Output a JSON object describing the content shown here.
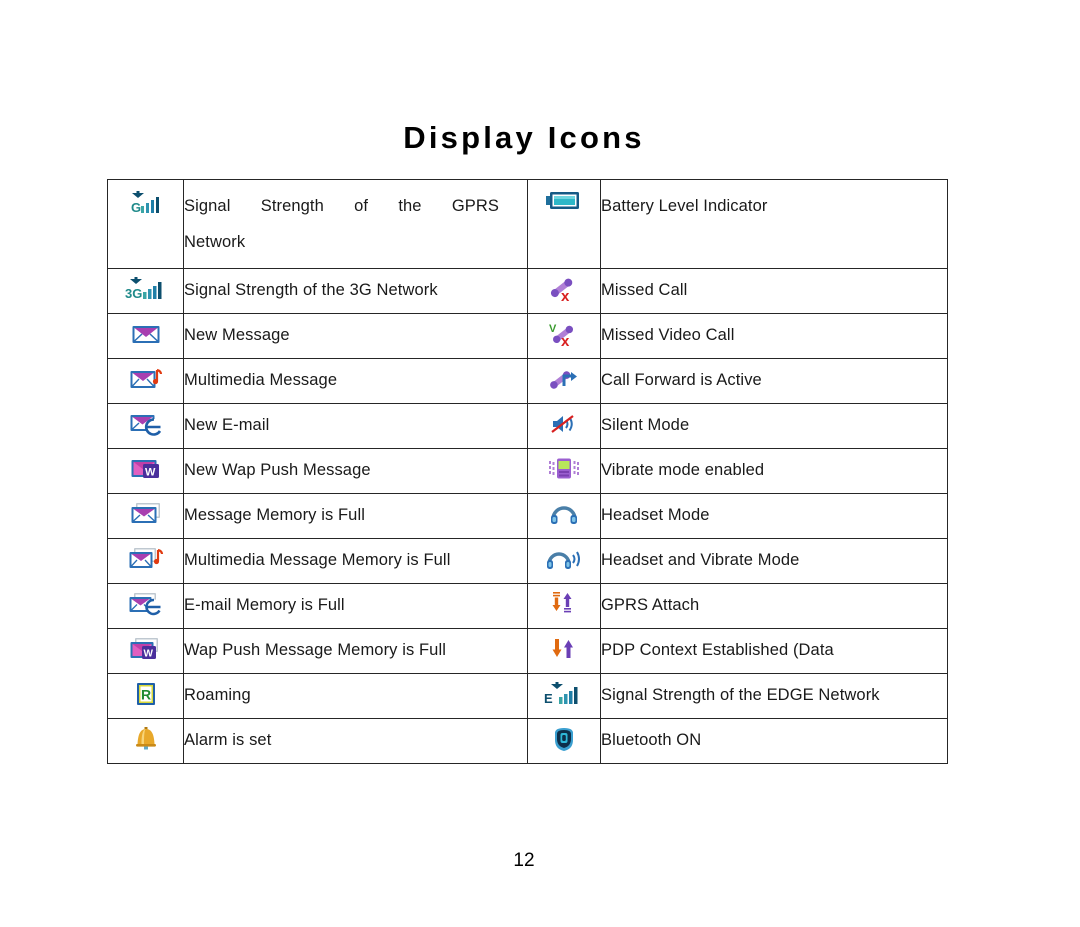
{
  "document": {
    "title": "Display Icons",
    "page_number": "12"
  },
  "table": {
    "left_column": [
      {
        "icon": "signal-strength-gprs-icon",
        "label_line1": "Signal Strength of the GPRS",
        "label_line2": "Network",
        "justified": true
      },
      {
        "icon": "signal-strength-3g-icon",
        "label_line1": "Signal Strength of the 3G Network",
        "label_line2": "",
        "justified": false
      },
      {
        "icon": "new-message-envelope-icon",
        "label_line1": "New Message",
        "label_line2": "",
        "justified": false
      },
      {
        "icon": "multimedia-message-icon",
        "label_line1": "Multimedia Message",
        "label_line2": "",
        "justified": false
      },
      {
        "icon": "new-email-icon",
        "label_line1": "New E-mail",
        "label_line2": "",
        "justified": false
      },
      {
        "icon": "new-wap-push-message-icon",
        "label_line1": "New Wap Push Message",
        "label_line2": "",
        "justified": false
      },
      {
        "icon": "message-memory-full-icon",
        "label_line1": "Message Memory is Full",
        "label_line2": "",
        "justified": false
      },
      {
        "icon": "multimedia-message-memory-full-icon",
        "label_line1": "Multimedia Message Memory is Full",
        "label_line2": "",
        "justified": false
      },
      {
        "icon": "email-memory-full-icon",
        "label_line1": "E-mail Memory is Full",
        "label_line2": "",
        "justified": false
      },
      {
        "icon": "wap-push-message-memory-full-icon",
        "label_line1": "Wap Push Message Memory is Full",
        "label_line2": "",
        "justified": false
      },
      {
        "icon": "roaming-icon",
        "label_line1": "Roaming",
        "label_line2": "",
        "justified": false
      },
      {
        "icon": "alarm-bell-icon",
        "label_line1": "Alarm is set",
        "label_line2": "",
        "justified": false
      }
    ],
    "right_column": [
      {
        "icon": "battery-level-icon",
        "label_line1": "Battery Level Indicator",
        "label_line2": "",
        "justified": false
      },
      {
        "icon": "missed-call-icon",
        "label_line1": "Missed Call",
        "label_line2": "",
        "justified": false
      },
      {
        "icon": "missed-video-call-icon",
        "label_line1": "Missed Video Call",
        "label_line2": "",
        "justified": false
      },
      {
        "icon": "call-forward-icon",
        "label_line1": "Call Forward is Active",
        "label_line2": "",
        "justified": false
      },
      {
        "icon": "silent-mode-icon",
        "label_line1": "Silent Mode",
        "label_line2": "",
        "justified": false
      },
      {
        "icon": "vibrate-mode-icon",
        "label_line1": "Vibrate mode enabled",
        "label_line2": "",
        "justified": false
      },
      {
        "icon": "headset-mode-icon",
        "label_line1": "Headset Mode",
        "label_line2": "",
        "justified": false
      },
      {
        "icon": "headset-vibrate-mode-icon",
        "label_line1": "Headset and Vibrate Mode",
        "label_line2": "",
        "justified": false
      },
      {
        "icon": "gprs-attach-icon",
        "label_line1": "GPRS Attach",
        "label_line2": "",
        "justified": false
      },
      {
        "icon": "pdp-context-icon",
        "label_line1": "PDP Context Established (Data",
        "label_line2": "",
        "justified": false
      },
      {
        "icon": "signal-strength-edge-icon",
        "label_line1": "Signal Strength of the EDGE Network",
        "label_line2": "",
        "justified": false
      },
      {
        "icon": "bluetooth-on-icon",
        "label_line1": "Bluetooth ON",
        "label_line2": "",
        "justified": false
      }
    ]
  },
  "colors": {
    "signal_teal": "#1f8a8a",
    "signal_dark": "#0d4f6e",
    "envelope_blue": "#2b6fb5",
    "envelope_purple": "#9b3fa8",
    "accent_red": "#d82020",
    "accent_orange": "#e06a10",
    "accent_purple": "#6a3fb5",
    "battery_teal": "#2eb8c8",
    "roaming_green": "#1f8a2f",
    "bell_gold": "#d99b20",
    "border": "#262626"
  }
}
